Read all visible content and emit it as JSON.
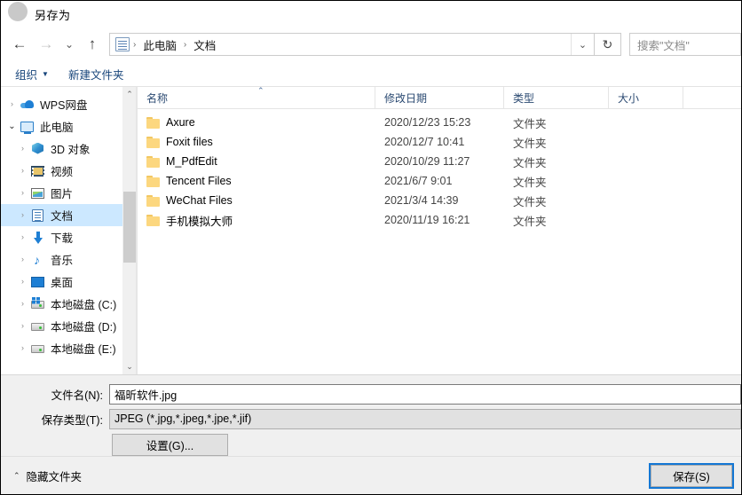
{
  "window": {
    "title": "另存为",
    "icon": "app-circle-icon"
  },
  "nav": {
    "back_icon": "←",
    "forward_icon": "→",
    "recent_icon": "⌄",
    "up_icon": "↑",
    "breadcrumb": {
      "icon": "documents-icon",
      "items": [
        "此电脑",
        "文档"
      ],
      "separator": "›"
    },
    "dropdown_icon": "⌄",
    "refresh_icon": "↻",
    "search_placeholder": "搜索\"文档\""
  },
  "toolbar": {
    "organize_label": "组织",
    "organize_caret": "▼",
    "new_folder_label": "新建文件夹"
  },
  "sidebar": {
    "items": [
      {
        "label": "WPS网盘",
        "icon": "cloud-icon",
        "expander": "›",
        "expanded": false,
        "indent": 0,
        "selected": false
      },
      {
        "label": "此电脑",
        "icon": "pc-icon",
        "expander": "⌄",
        "expanded": true,
        "indent": 0,
        "selected": false
      },
      {
        "label": "3D 对象",
        "icon": "3d-objects-icon",
        "expander": "›",
        "expanded": false,
        "indent": 1,
        "selected": false
      },
      {
        "label": "视频",
        "icon": "videos-icon",
        "expander": "›",
        "expanded": false,
        "indent": 1,
        "selected": false
      },
      {
        "label": "图片",
        "icon": "pictures-icon",
        "expander": "›",
        "expanded": false,
        "indent": 1,
        "selected": false
      },
      {
        "label": "文档",
        "icon": "documents-icon",
        "expander": "›",
        "expanded": false,
        "indent": 1,
        "selected": true
      },
      {
        "label": "下载",
        "icon": "downloads-icon",
        "expander": "›",
        "expanded": false,
        "indent": 1,
        "selected": false
      },
      {
        "label": "音乐",
        "icon": "music-icon",
        "expander": "›",
        "expanded": false,
        "indent": 1,
        "selected": false
      },
      {
        "label": "桌面",
        "icon": "desktop-icon",
        "expander": "›",
        "expanded": false,
        "indent": 1,
        "selected": false
      },
      {
        "label": "本地磁盘 (C:)",
        "icon": "system-drive-icon",
        "expander": "›",
        "expanded": false,
        "indent": 1,
        "selected": false
      },
      {
        "label": "本地磁盘 (D:)",
        "icon": "drive-icon",
        "expander": "›",
        "expanded": false,
        "indent": 1,
        "selected": false
      },
      {
        "label": "本地磁盘 (E:)",
        "icon": "drive-icon",
        "expander": "›",
        "expanded": false,
        "indent": 1,
        "selected": false
      }
    ],
    "scroll_up_icon": "⌃",
    "scroll_down_icon": "⌄"
  },
  "filelist": {
    "columns": [
      "名称",
      "修改日期",
      "类型",
      "大小"
    ],
    "sort_caret": "⌃",
    "rows": [
      {
        "name": "Axure",
        "date": "2020/12/23 15:23",
        "type": "文件夹",
        "size": "",
        "icon": "folder-icon"
      },
      {
        "name": "Foxit files",
        "date": "2020/12/7 10:41",
        "type": "文件夹",
        "size": "",
        "icon": "folder-icon"
      },
      {
        "name": "M_PdfEdit",
        "date": "2020/10/29 11:27",
        "type": "文件夹",
        "size": "",
        "icon": "folder-icon"
      },
      {
        "name": "Tencent Files",
        "date": "2021/6/7 9:01",
        "type": "文件夹",
        "size": "",
        "icon": "folder-icon"
      },
      {
        "name": "WeChat Files",
        "date": "2021/3/4 14:39",
        "type": "文件夹",
        "size": "",
        "icon": "folder-icon"
      },
      {
        "name": "手机模拟大师",
        "date": "2020/11/19 16:21",
        "type": "文件夹",
        "size": "",
        "icon": "folder-icon"
      }
    ]
  },
  "form": {
    "filename_label": "文件名(N):",
    "filename_value": "福昕软件.jpg",
    "filetype_label": "保存类型(T):",
    "filetype_value": "JPEG (*.jpg,*.jpeg,*.jpe,*.jif)",
    "settings_label": "设置(G)..."
  },
  "footer": {
    "hide_folders_label": "隐藏文件夹",
    "hide_folders_caret": "⌃",
    "save_label": "保存(S)"
  },
  "colors": {
    "selection": "#cce8ff",
    "focus_outline": "#1477d4",
    "link_text": "#16447a",
    "folder": "#fcd77f"
  }
}
